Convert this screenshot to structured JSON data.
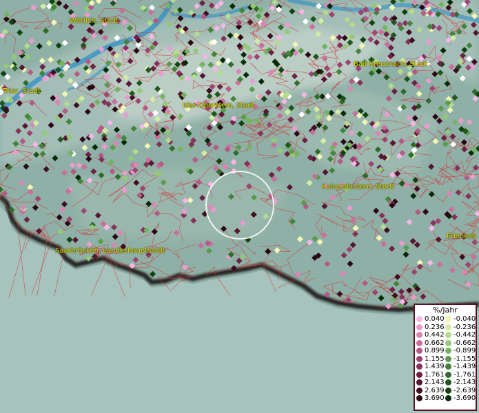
{
  "cities": [
    {
      "name": "Wittlich, Stadt"
    },
    {
      "name": "Bad Kreuznach, Stadt"
    },
    {
      "name": "Trier, Stadt"
    },
    {
      "name": "Idar-Oberstein, Stadt"
    },
    {
      "name": "Kaiserslautern, Stadt"
    },
    {
      "name": "Edenkob"
    },
    {
      "name": "Saarbrücken, Landeshauptstadt"
    }
  ],
  "legend": {
    "title": "%/Jahr",
    "positive": [
      {
        "value": "0.040",
        "color": "#f5b6e8"
      },
      {
        "value": "0.236",
        "color": "#e89ccf"
      },
      {
        "value": "0.442",
        "color": "#d986b6"
      },
      {
        "value": "0.662",
        "color": "#c86f9c"
      },
      {
        "value": "0.899",
        "color": "#b45a84"
      },
      {
        "value": "1.155",
        "color": "#9c4570"
      },
      {
        "value": "1.439",
        "color": "#84325a"
      },
      {
        "value": "1.761",
        "color": "#6c2244"
      },
      {
        "value": "2.143",
        "color": "#561632"
      },
      {
        "value": "2.639",
        "color": "#400c22"
      },
      {
        "value": "3.690",
        "color": "#2a0614"
      }
    ],
    "negative": [
      {
        "value": "-0.040",
        "color": "#f2f6b4"
      },
      {
        "value": "-0.236",
        "color": "#d4eca2"
      },
      {
        "value": "-0.442",
        "color": "#b4dc8c"
      },
      {
        "value": "-0.662",
        "color": "#94ca76"
      },
      {
        "value": "-0.899",
        "color": "#74b460"
      },
      {
        "value": "-1.155",
        "color": "#5a9c4c"
      },
      {
        "value": "-1.439",
        "color": "#44843a"
      },
      {
        "value": "-1.761",
        "color": "#306c2a"
      },
      {
        "value": "-2.143",
        "color": "#20561c"
      },
      {
        "value": "-2.639",
        "color": "#124210"
      },
      {
        "value": "-3.690",
        "color": "#062a06"
      }
    ]
  }
}
